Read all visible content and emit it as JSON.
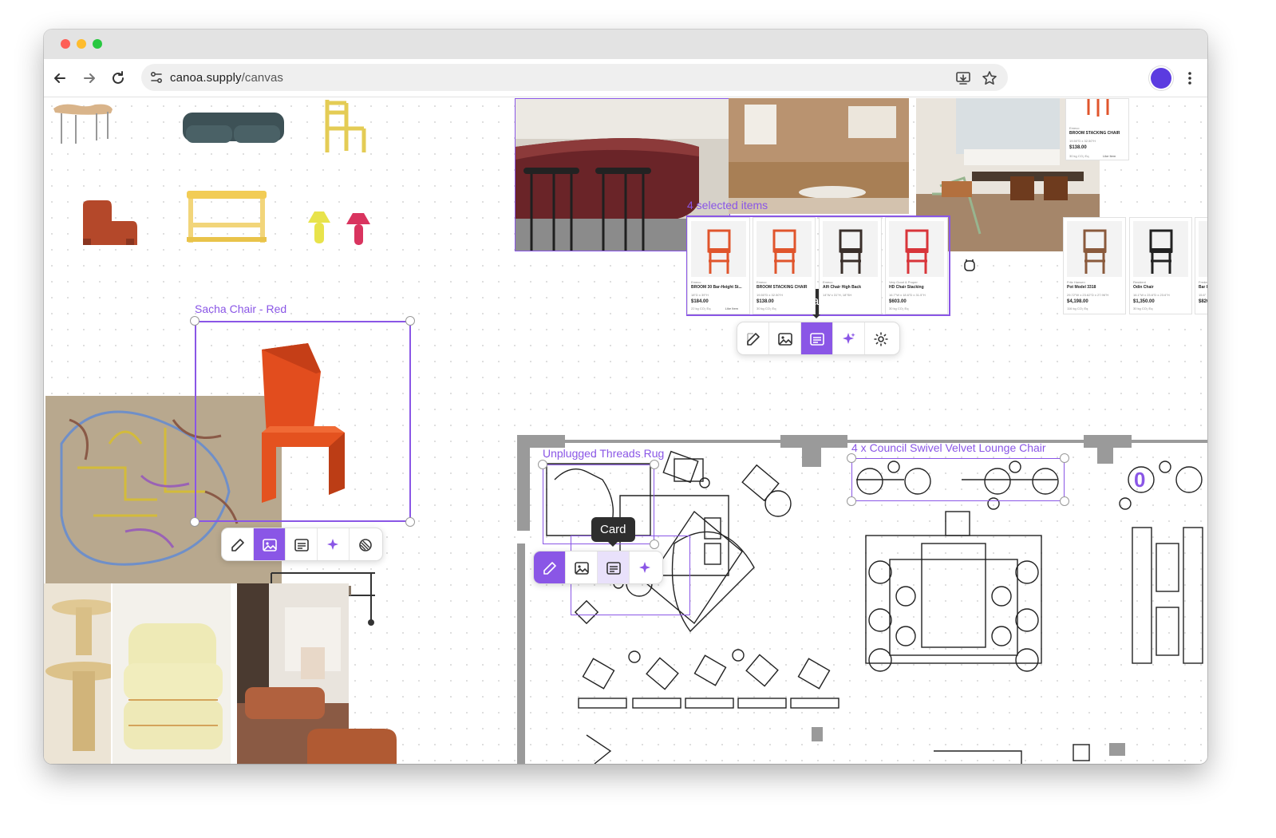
{
  "browser": {
    "url_domain": "canoa.supply",
    "url_path": "/canvas",
    "avatar_color": "#5b3be0",
    "traffic_lights": [
      "#fe5f57",
      "#febc2e",
      "#28c840"
    ]
  },
  "canvas": {
    "accent_color": "#8a56e6",
    "sacha": {
      "label": "Sacha Chair - Red"
    },
    "selection": {
      "label": "4 selected items"
    },
    "rug": {
      "label": "Unplugged Threads Rug"
    },
    "lounge": {
      "label": "4 x Council Swivel Velvet Lounge Chair"
    },
    "tooltips": {
      "card_top": "Card",
      "card_bottom": "Card"
    },
    "toolbars": {
      "top": [
        "edit-icon",
        "image-icon",
        "card-icon",
        "sparkles-icon",
        "gear-icon"
      ],
      "sacha": [
        "edit-icon",
        "image-icon",
        "card-icon",
        "sparkles-icon",
        "texture-icon"
      ],
      "rug": [
        "edit-icon",
        "image-icon",
        "card-icon",
        "sparkles-icon"
      ]
    }
  },
  "product_cards": [
    {
      "brand": "Emeco",
      "name": "BROOM 30 Bar-Height St...",
      "dims": "18\"D x 39\"H",
      "price": "$184.00",
      "co2": "22 kg CO₂ Eq",
      "like": "Like Item",
      "color": "#e0552c"
    },
    {
      "brand": "Emeco",
      "name": "BROOM STACKING CHAIR",
      "dims": "19.50\"D x 32.50\"H",
      "price": "$138.00",
      "co2": "30 kg CO₂ Eq",
      "like": "",
      "color": "#e0552c"
    },
    {
      "brand": "Emeco",
      "name": "Alfi Chair High Back",
      "dims": "14\"W x 31\"H, 18\"SH",
      "price": "",
      "co2": "",
      "like": "",
      "color": "#3a2f2a"
    },
    {
      "brand": "Very Good & Proper",
      "name": "HD Chair Stacking",
      "dims": "16.7\"W x 18.6\"D x 31.5\"H",
      "price": "$603.00",
      "co2": "30 kg CO₂ Eq",
      "like": "",
      "color": "#d8353a"
    },
    {
      "brand": "Fritz Hansen",
      "name": "Pot Model 3318",
      "dims": "29.72\"W x 23.62\"D x 27.96\"H",
      "price": "$4,198.00",
      "co2": "116 kg CO₂ Eq",
      "like": "",
      "color": "#8a5a3c"
    },
    {
      "brand": "Resident",
      "name": "Odin Chair",
      "dims": "16.1\"W x 23.6\"D x 23.6\"H",
      "price": "$1,350.00",
      "co2": "30 kg CO₂ Eq",
      "like": "",
      "color": "#222222"
    },
    {
      "brand": "Fredericia",
      "name": "Bar I",
      "dims": "15.6\"",
      "price": "$826",
      "co2": "",
      "like": "",
      "color": "#c9a27a"
    }
  ],
  "top_card": {
    "brand": "Emeco",
    "name": "BROOM STACKING CHAIR",
    "dims": "19.50\"D x 32.50\"H",
    "price": "$138.00",
    "co2": "30 kg CO₂ Eq",
    "like": "Like Item"
  }
}
